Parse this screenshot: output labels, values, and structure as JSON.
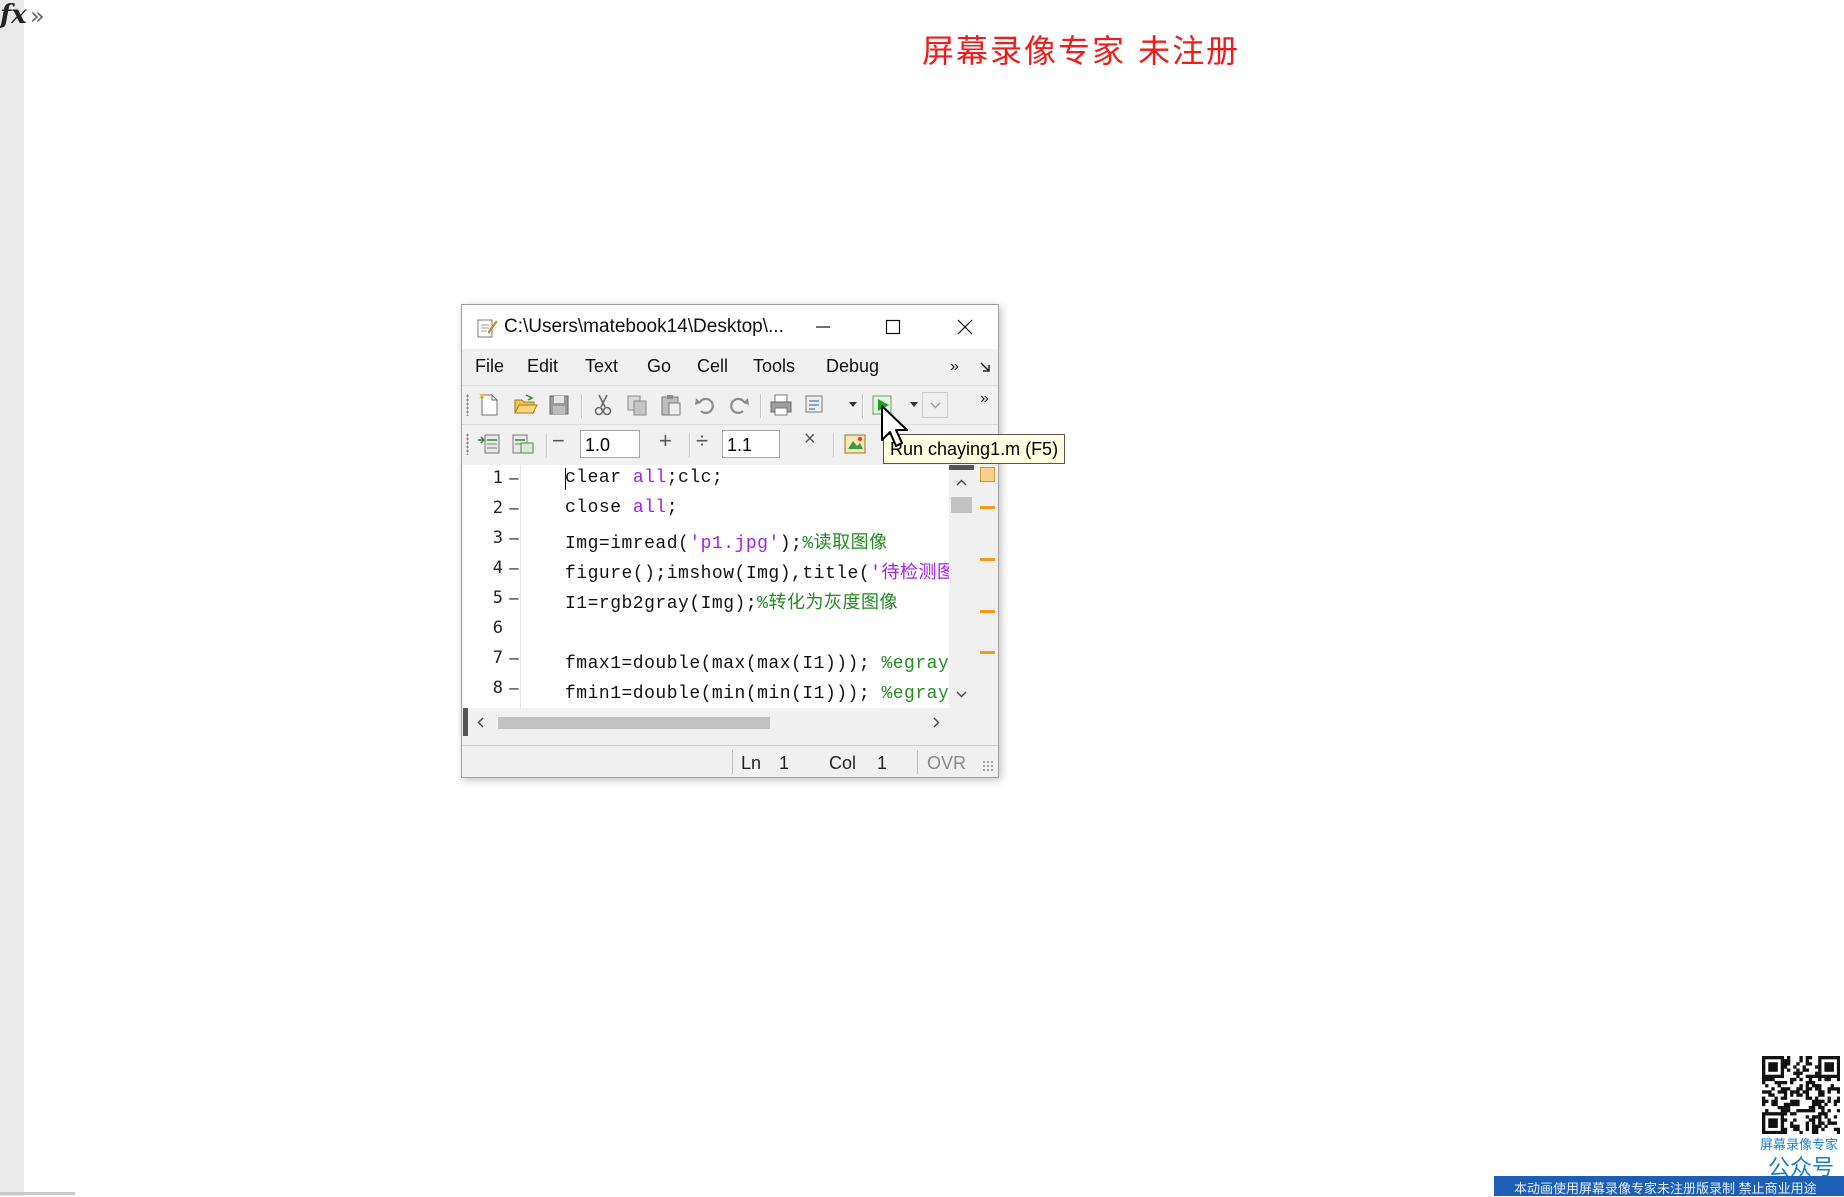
{
  "command": {
    "fx_label": "fx",
    "more_glyph": "»"
  },
  "watermark_top": "屏幕录像专家 未注册",
  "editor": {
    "title": "C:\\Users\\matebook14\\Desktop\\...",
    "menus": [
      "File",
      "Edit",
      "Text",
      "Go",
      "Cell",
      "Tools",
      "Debug"
    ],
    "menu_overflow": "»",
    "toolbar_overflow": "»",
    "cell_toolbar": {
      "minus": "−",
      "value1": "1.0",
      "plus": "+",
      "divide": "÷",
      "value2": "1.1",
      "times": "×"
    },
    "code_lines": [
      {
        "num": "1",
        "mark": "–",
        "segments": [
          {
            "t": "clear ",
            "c": ""
          },
          {
            "t": "all",
            "c": "kw"
          },
          {
            "t": ";clc;",
            "c": ""
          }
        ]
      },
      {
        "num": "2",
        "mark": "–",
        "segments": [
          {
            "t": "close ",
            "c": ""
          },
          {
            "t": "all",
            "c": "kw"
          },
          {
            "t": ";",
            "c": ""
          }
        ]
      },
      {
        "num": "3",
        "mark": "–",
        "segments": [
          {
            "t": "Img=imread(",
            "c": ""
          },
          {
            "t": "'p1.jpg'",
            "c": "kw"
          },
          {
            "t": ");",
            "c": ""
          },
          {
            "t": "%读取图像",
            "c": "cm"
          }
        ]
      },
      {
        "num": "4",
        "mark": "–",
        "segments": [
          {
            "t": "figure();imshow(Img),title(",
            "c": ""
          },
          {
            "t": "'待检测图像",
            "c": "kw"
          }
        ]
      },
      {
        "num": "5",
        "mark": "–",
        "segments": [
          {
            "t": "I1=rgb2gray(Img);",
            "c": ""
          },
          {
            "t": "%转化为灰度图像",
            "c": "cm"
          }
        ]
      },
      {
        "num": "6",
        "mark": "",
        "segments": []
      },
      {
        "num": "7",
        "mark": "–",
        "segments": [
          {
            "t": "fmax1=double(max(max(I1))); ",
            "c": ""
          },
          {
            "t": "%egray的最",
            "c": "cm"
          }
        ]
      },
      {
        "num": "8",
        "mark": "–",
        "segments": [
          {
            "t": "fmin1=double(min(min(I1))); ",
            "c": ""
          },
          {
            "t": "%egray的最",
            "c": "cm"
          }
        ]
      }
    ],
    "status": {
      "ln_label": "Ln",
      "ln_value": "1",
      "col_label": "Col",
      "col_value": "1",
      "ovr": "OVR"
    }
  },
  "tooltip": "Run chaying1.m (F5)",
  "qr": {
    "label1": "屏幕录像专家",
    "label2": "公众号"
  },
  "banner_bottom": "本动画使用屏幕录像专家未注册版录制 禁止商业用途",
  "colors": {
    "keyword": "#a020f0",
    "comment": "#228b22",
    "watermark": "#ee1c1c",
    "marker": "#f29a1e"
  }
}
